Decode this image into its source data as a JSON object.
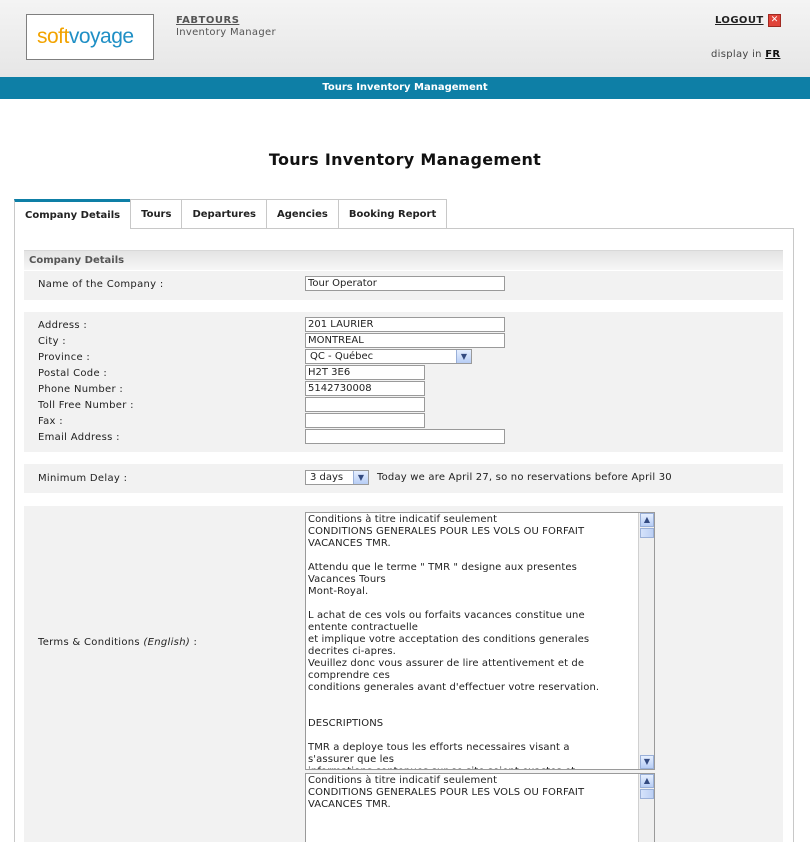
{
  "header": {
    "logo_part1": "soft",
    "logo_part2": "voyage",
    "company": "FABTOURS",
    "subtitle": "Inventory Manager",
    "logout_label": "LOGOUT",
    "display_in_label": "display in",
    "language": "FR"
  },
  "bar_title": "Tours Inventory Management",
  "page_title": "Tours Inventory Management",
  "tabs": [
    {
      "label": "Company Details",
      "active": true
    },
    {
      "label": "Tours"
    },
    {
      "label": "Departures"
    },
    {
      "label": "Agencies"
    },
    {
      "label": "Booking Report"
    }
  ],
  "section_title": "Company Details",
  "form": {
    "company_name_label": "Name of the Company :",
    "company_name_value": "Tour Operator",
    "address_label": "Address :",
    "address_value": "201 LAURIER",
    "city_label": "City :",
    "city_value": "MONTREAL",
    "province_label": "Province :",
    "province_value": "QC - Québec",
    "postal_label": "Postal Code :",
    "postal_value": "H2T 3E6",
    "phone_label": "Phone Number :",
    "phone_value": "5142730008",
    "tollfree_label": "Toll Free Number :",
    "tollfree_value": "",
    "fax_label": "Fax :",
    "fax_value": "",
    "email_label": "Email Address :",
    "email_value": "",
    "min_delay_label": "Minimum Delay :",
    "min_delay_value": "3 days",
    "min_delay_note": "Today we are April 27, so no reservations before April 30",
    "terms_label_prefix": "Terms & Conditions",
    "terms_label_lang": "(English)",
    "terms_label_suffix": ":",
    "terms_en_text": "Conditions à titre indicatif seulement\nCONDITIONS GENERALES POUR LES VOLS OU FORFAIT\nVACANCES TMR.\n\nAttendu que le terme \" TMR \" designe aux presentes\nVacances Tours\nMont-Royal.\n\nL achat de ces vols ou forfaits vacances constitue une\nentente contractuelle\net implique votre acceptation des conditions generales\ndecrites ci-apres.\nVeuillez donc vous assurer de lire attentivement et de\ncomprendre ces\nconditions generales avant d'effectuer votre reservation.\n\n\nDESCRIPTIONS\n\nTMR a deploye tous les efforts necessaires visant a\ns'assurer que les\ninformations contenues sur ce site soient exactes et",
    "terms_fr_text": "Conditions à titre indicatif seulement\nCONDITIONS GENERALES POUR LES VOLS OU FORFAIT\nVACANCES TMR."
  }
}
